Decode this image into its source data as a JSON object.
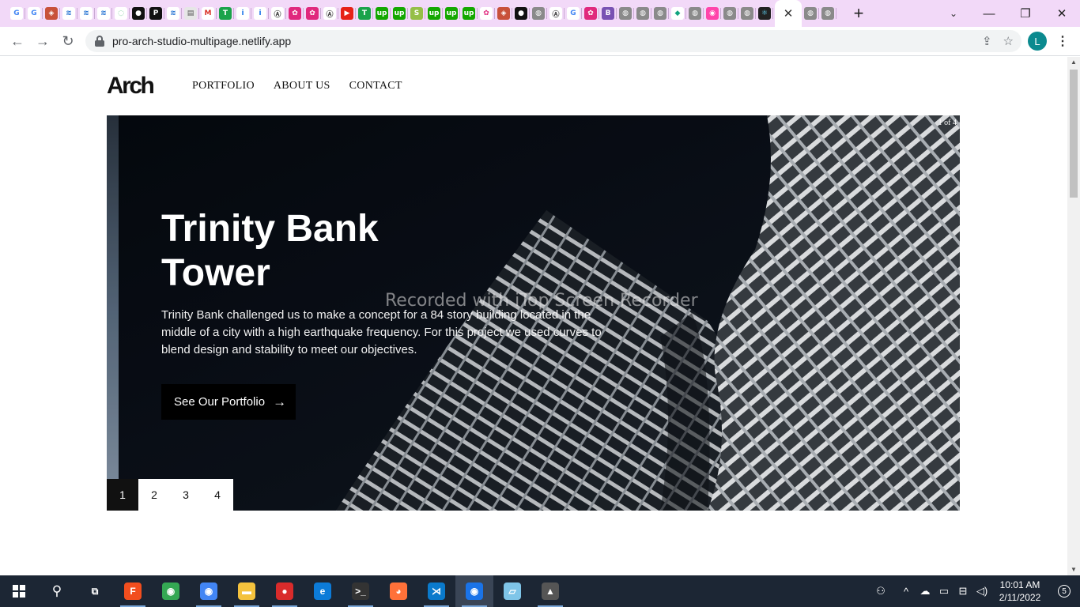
{
  "browser": {
    "tab_favicons": [
      {
        "name": "google-icon",
        "color": "#ffffff",
        "glyph": "G",
        "fg": "#4285f4"
      },
      {
        "name": "google-icon",
        "color": "#ffffff",
        "glyph": "G",
        "fg": "#4285f4"
      },
      {
        "name": "shield-icon",
        "color": "#c8513a",
        "glyph": "◈",
        "fg": "#fff"
      },
      {
        "name": "mw-icon",
        "color": "#ffffff",
        "glyph": "≋",
        "fg": "#1f6fd1"
      },
      {
        "name": "mw-icon",
        "color": "#ffffff",
        "glyph": "≋",
        "fg": "#1f6fd1"
      },
      {
        "name": "mw-icon",
        "color": "#ffffff",
        "glyph": "≋",
        "fg": "#1f6fd1"
      },
      {
        "name": "page-icon",
        "color": "#ffffff",
        "glyph": "◌",
        "fg": "#7c9"
      },
      {
        "name": "github-icon",
        "color": "#111111",
        "glyph": "●",
        "fg": "#fff"
      },
      {
        "name": "p-icon",
        "color": "#111111",
        "glyph": "P",
        "fg": "#fff"
      },
      {
        "name": "mw-icon",
        "color": "#ffffff",
        "glyph": "≋",
        "fg": "#1f6fd1"
      },
      {
        "name": "doc-icon",
        "color": "#e6e6e6",
        "glyph": "▤",
        "fg": "#555"
      },
      {
        "name": "gmail-icon",
        "color": "#ffffff",
        "glyph": "M",
        "fg": "#d93025"
      },
      {
        "name": "tag-icon",
        "color": "#1aa34a",
        "glyph": "T",
        "fg": "#fff"
      },
      {
        "name": "info-icon",
        "color": "#ffffff",
        "glyph": "i",
        "fg": "#1a73e8"
      },
      {
        "name": "info-icon",
        "color": "#ffffff",
        "glyph": "i",
        "fg": "#1a73e8"
      },
      {
        "name": "a-circle-icon",
        "color": "#ffffff",
        "glyph": "Ⓐ",
        "fg": "#333"
      },
      {
        "name": "flower-icon",
        "color": "#e0287d",
        "glyph": "✿",
        "fg": "#fff"
      },
      {
        "name": "flower-icon",
        "color": "#e0287d",
        "glyph": "✿",
        "fg": "#fff"
      },
      {
        "name": "a-circle-icon",
        "color": "#ffffff",
        "glyph": "Ⓐ",
        "fg": "#333"
      },
      {
        "name": "youtube-icon",
        "color": "#e62117",
        "glyph": "▶",
        "fg": "#fff"
      },
      {
        "name": "tag-icon",
        "color": "#1aa34a",
        "glyph": "T",
        "fg": "#fff"
      },
      {
        "name": "upwork-icon",
        "color": "#14a800",
        "glyph": "up",
        "fg": "#fff"
      },
      {
        "name": "upwork-icon",
        "color": "#14a800",
        "glyph": "up",
        "fg": "#fff"
      },
      {
        "name": "shopify-icon",
        "color": "#95bf47",
        "glyph": "S",
        "fg": "#fff"
      },
      {
        "name": "upwork-icon",
        "color": "#14a800",
        "glyph": "up",
        "fg": "#fff"
      },
      {
        "name": "upwork-icon",
        "color": "#14a800",
        "glyph": "up",
        "fg": "#fff"
      },
      {
        "name": "upwork-icon",
        "color": "#14a800",
        "glyph": "up",
        "fg": "#fff"
      },
      {
        "name": "flower-outline-icon",
        "color": "#ffffff",
        "glyph": "✿",
        "fg": "#e0287d"
      },
      {
        "name": "shield-icon",
        "color": "#c8513a",
        "glyph": "◈",
        "fg": "#fff"
      },
      {
        "name": "github-icon",
        "color": "#111111",
        "glyph": "●",
        "fg": "#fff"
      },
      {
        "name": "globe-icon",
        "color": "#8a8a8a",
        "glyph": "◍",
        "fg": "#fff"
      },
      {
        "name": "a-circle-icon",
        "color": "#ffffff",
        "glyph": "Ⓐ",
        "fg": "#333"
      },
      {
        "name": "google-icon",
        "color": "#ffffff",
        "glyph": "G",
        "fg": "#4285f4"
      },
      {
        "name": "flower-icon",
        "color": "#e0287d",
        "glyph": "✿",
        "fg": "#fff"
      },
      {
        "name": "bootstrap-icon",
        "color": "#7952b3",
        "glyph": "B",
        "fg": "#fff"
      },
      {
        "name": "globe-icon",
        "color": "#8a8a8a",
        "glyph": "◍",
        "fg": "#fff"
      },
      {
        "name": "globe-icon",
        "color": "#8a8a8a",
        "glyph": "◍",
        "fg": "#fff"
      },
      {
        "name": "globe-icon",
        "color": "#8a8a8a",
        "glyph": "◍",
        "fg": "#fff"
      },
      {
        "name": "diamond-icon",
        "color": "#ffffff",
        "glyph": "◆",
        "fg": "#10a37f"
      },
      {
        "name": "globe-icon",
        "color": "#8a8a8a",
        "glyph": "◍",
        "fg": "#fff"
      },
      {
        "name": "palette-icon",
        "color": "#f4a",
        "glyph": "◉",
        "fg": "#fff"
      },
      {
        "name": "globe-icon",
        "color": "#8a8a8a",
        "glyph": "◍",
        "fg": "#fff"
      },
      {
        "name": "globe-icon",
        "color": "#8a8a8a",
        "glyph": "◍",
        "fg": "#fff"
      },
      {
        "name": "react-icon",
        "color": "#222222",
        "glyph": "⚛",
        "fg": "#61dafb"
      }
    ],
    "after_active_favicons": [
      {
        "name": "globe-icon",
        "color": "#8a8a8a",
        "glyph": "◍",
        "fg": "#fff"
      },
      {
        "name": "globe-icon",
        "color": "#8a8a8a",
        "glyph": "◍",
        "fg": "#fff"
      }
    ],
    "url": "pro-arch-studio-multipage.netlify.app",
    "profile_initial": "L"
  },
  "site": {
    "logo": "Arch",
    "nav": [
      "PORTFOLIO",
      "ABOUT US",
      "CONTACT"
    ]
  },
  "hero": {
    "counter": "1 of 4",
    "title": "Trinity Bank Tower",
    "description": "Trinity Bank challenged us to make a concept for a 84 story building located in the middle of a city with a high earthquake frequency. For this project we used curves to blend design and stability to meet our objectives.",
    "button_label": "See Our Portfolio",
    "pages": [
      "1",
      "2",
      "3",
      "4"
    ],
    "active_page": "1",
    "watermark": "Recorded with iTop Screen Recorder"
  },
  "taskbar": {
    "apps": [
      {
        "name": "task-view-icon",
        "glyph": "⧉",
        "color": "transparent",
        "open": false
      },
      {
        "name": "figma-icon",
        "glyph": "F",
        "color": "#f24e1e",
        "open": true
      },
      {
        "name": "chrome-icon",
        "glyph": "◉",
        "color": "#34a853",
        "open": false
      },
      {
        "name": "chrome-profile-icon",
        "glyph": "◉",
        "color": "#4285f4",
        "open": true
      },
      {
        "name": "file-explorer-icon",
        "glyph": "▬",
        "color": "#f4c23d",
        "open": true
      },
      {
        "name": "screen-recorder-icon",
        "glyph": "●",
        "color": "#d92b2b",
        "open": true
      },
      {
        "name": "edge-icon",
        "glyph": "e",
        "color": "#0c7bd8",
        "open": false
      },
      {
        "name": "terminal-icon",
        "glyph": ">_",
        "color": "#333333",
        "open": true
      },
      {
        "name": "firefox-icon",
        "glyph": "◕",
        "color": "#ff7139",
        "open": false
      },
      {
        "name": "vscode-icon",
        "glyph": "⋊",
        "color": "#0a7acc",
        "open": true
      },
      {
        "name": "chrome-active-icon",
        "glyph": "◉",
        "color": "#1a73e8",
        "open": true,
        "current": true
      },
      {
        "name": "notepad-icon",
        "glyph": "▱",
        "color": "#7fc5e8",
        "open": false
      },
      {
        "name": "photos-icon",
        "glyph": "▲",
        "color": "#555555",
        "open": true
      }
    ],
    "time": "10:01 AM",
    "date": "2/11/2022",
    "notification_count": "5"
  }
}
